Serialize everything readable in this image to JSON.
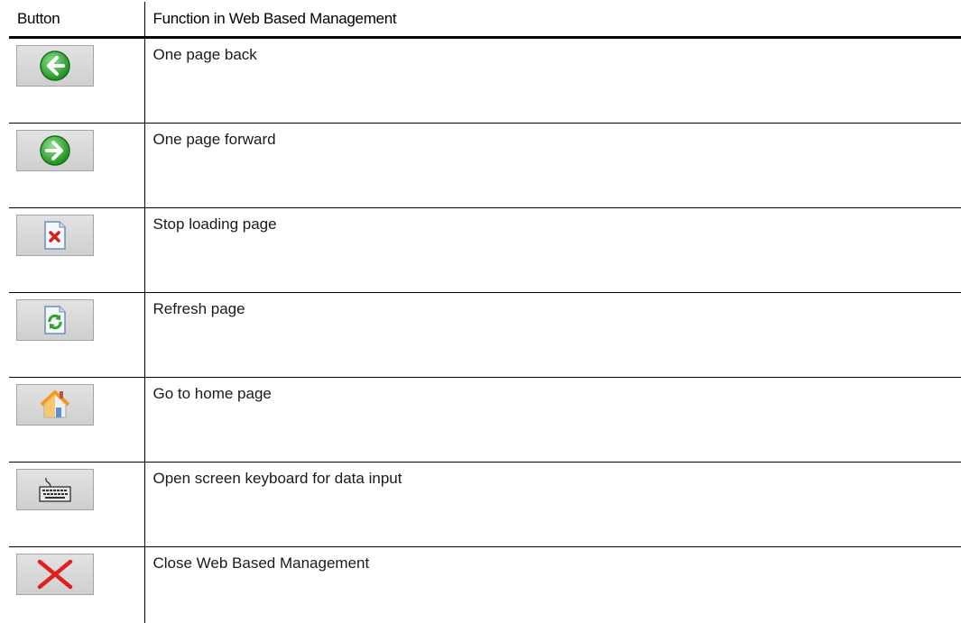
{
  "table": {
    "headers": [
      "Button",
      "Function in Web Based Management"
    ],
    "rows": [
      {
        "icon": "back-arrow-icon",
        "function": "One page back"
      },
      {
        "icon": "forward-arrow-icon",
        "function": "One page forward"
      },
      {
        "icon": "stop-icon",
        "function": "Stop loading page"
      },
      {
        "icon": "refresh-icon",
        "function": "Refresh page"
      },
      {
        "icon": "home-icon",
        "function": "Go to home page"
      },
      {
        "icon": "keyboard-icon",
        "function": "Open screen keyboard for data input"
      },
      {
        "icon": "close-x-icon",
        "function": "Close Web Based Management"
      }
    ]
  },
  "colors": {
    "green": "#2aa52a",
    "red": "#e02020",
    "button_bg": "#d8d8d8"
  }
}
